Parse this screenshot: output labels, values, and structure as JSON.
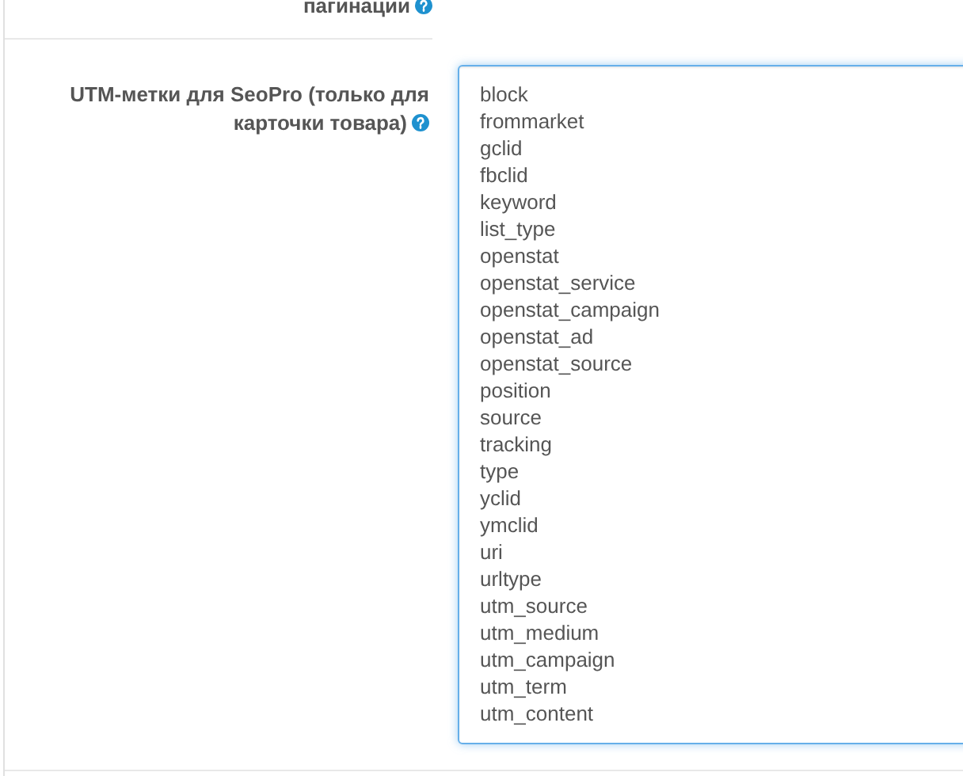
{
  "previous_field": {
    "label": "пагинации"
  },
  "utm_field": {
    "label": "UTM-метки для SeoPro (только для карточки товара)",
    "values": [
      "block",
      "frommarket",
      "gclid",
      "fbclid",
      "keyword",
      "list_type",
      "openstat",
      "openstat_service",
      "openstat_campaign",
      "openstat_ad",
      "openstat_source",
      "position",
      "source",
      "tracking",
      "type",
      "yclid",
      "ymclid",
      "uri",
      "urltype",
      "utm_source",
      "utm_medium",
      "utm_campaign",
      "utm_term",
      "utm_content"
    ]
  }
}
